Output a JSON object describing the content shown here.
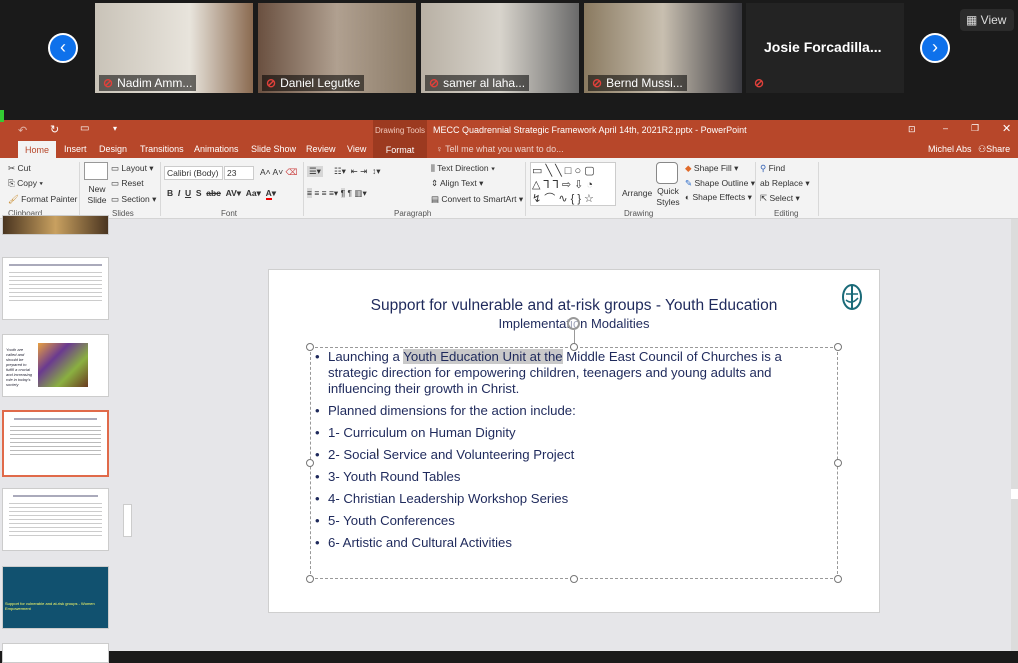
{
  "meeting": {
    "participants": [
      {
        "name": "Nadim Amm...",
        "muted": true
      },
      {
        "name": "Daniel Legutke",
        "muted": true
      },
      {
        "name": "samer al laha...",
        "muted": true
      },
      {
        "name": "Bernd Mussi...",
        "muted": true
      },
      {
        "name": "Josie  Forcadilla...",
        "muted": true
      }
    ],
    "view_label": "View",
    "accent": "#0e71eb"
  },
  "titlebar": {
    "context_tab": "Drawing Tools",
    "title": "MECC Quadrennial Strategic Framework April 14th, 2021R2.pptx - PowerPoint",
    "user": "Michel Abs",
    "share": "Share"
  },
  "tabs": [
    "Home",
    "Insert",
    "Design",
    "Transitions",
    "Animations",
    "Slide Show",
    "Review",
    "View",
    "Format"
  ],
  "tell_me": "Tell me what you want to do...",
  "ribbon": {
    "clipboard": {
      "cut": "Cut",
      "copy": "Copy",
      "format_painter": "Format Painter",
      "label": "Clipboard"
    },
    "slides": {
      "new_slide": "New Slide",
      "layout": "Layout",
      "reset": "Reset",
      "section": "Section",
      "label": "Slides"
    },
    "font": {
      "family": "Calibri (Body)",
      "size": "23",
      "label": "Font"
    },
    "paragraph": {
      "text_direction": "Text Direction",
      "align_text": "Align Text",
      "convert": "Convert to SmartArt",
      "label": "Paragraph"
    },
    "drawing": {
      "arrange": "Arrange",
      "quick_styles": "Quick Styles",
      "shape_fill": "Shape Fill",
      "shape_outline": "Shape Outline",
      "shape_effects": "Shape Effects",
      "label": "Drawing"
    },
    "editing": {
      "find": "Find",
      "replace": "Replace",
      "select": "Select",
      "label": "Editing"
    }
  },
  "thumbnails": {
    "word_cloud_caption": "Youth are called and should be prepared to fulfill a crucial and increasing role in today's society",
    "dark_slide_title": "Support for vulnerable and at-risk groups - Women Empowerment"
  },
  "slide": {
    "title": "Support for vulnerable and at-risk groups - Youth Education",
    "subtitle": "Implementation Modalities",
    "bullet1": {
      "pre": "Launching a ",
      "highlight": "Youth Education Unit at the",
      "post": " Middle East Council of Churches is a",
      "line2": "strategic direction for empowering children, teenagers and young adults and",
      "line3": "influencing their growth in Christ."
    },
    "bullets": [
      "Planned dimensions for the action include:",
      "1- Curriculum on Human Dignity",
      "2- Social Service and Volunteering Project",
      "3- Youth Round Tables",
      "4- Christian Leadership Workshop Series",
      "5- Youth Conferences",
      "6- Artistic and Cultural Activities"
    ],
    "text_color": "#1f2a5c"
  }
}
